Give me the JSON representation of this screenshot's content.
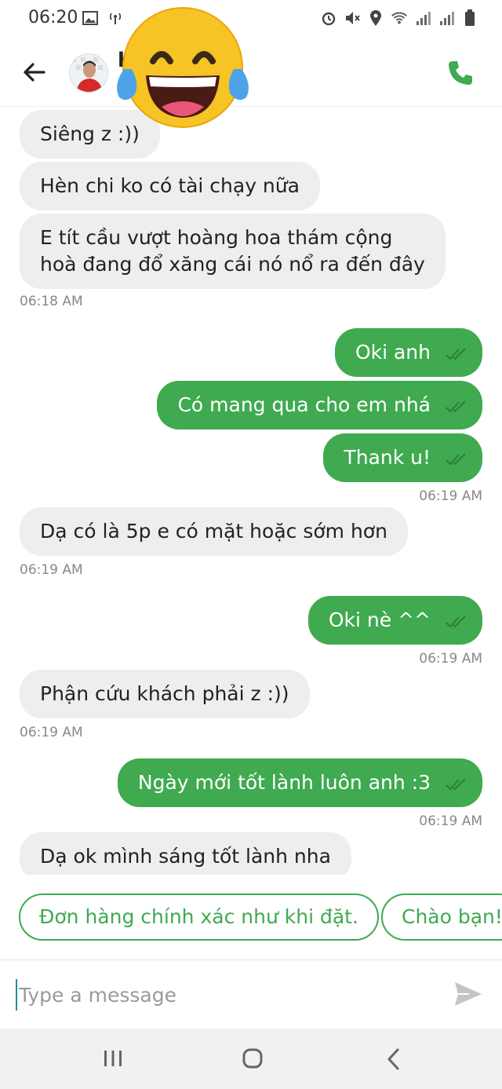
{
  "status_bar": {
    "time": "06:20",
    "icons_left": [
      "image-icon",
      "hotspot-icon"
    ],
    "icons_right": [
      "alarm-icon",
      "mute-icon",
      "location-icon",
      "wifi-icon",
      "signal-icon",
      "signal-icon",
      "battery-icon"
    ]
  },
  "header": {
    "contact_name": "b        y",
    "icons": [
      "back-arrow-icon",
      "phone-icon"
    ],
    "accent_color": "#3faa4f"
  },
  "messages": [
    {
      "dir": "in",
      "text": "Siêng z :))"
    },
    {
      "dir": "in",
      "text": "Hèn chi ko có tài chạy nữa"
    },
    {
      "dir": "in",
      "text_lines": [
        "E tít cầu vượt hoàng hoa thám cộng",
        "hoà đang đổ xăng cái nó nổ ra đến đây"
      ]
    },
    {
      "dir": "time",
      "text": "06:18 AM"
    },
    {
      "dir": "out",
      "text": "Oki anh"
    },
    {
      "dir": "out",
      "text": "Có mang qua cho em nhá"
    },
    {
      "dir": "out",
      "text": "Thank u!"
    },
    {
      "dir": "time",
      "text": "06:19 AM"
    },
    {
      "dir": "in",
      "text": "Dạ có là 5p e có mặt hoặc sớm hơn"
    },
    {
      "dir": "time",
      "text": "06:19 AM"
    },
    {
      "dir": "out",
      "text": "Oki nè ^^"
    },
    {
      "dir": "time",
      "text": "06:19 AM"
    },
    {
      "dir": "in",
      "text": "Phận cứu khách phải z :))"
    },
    {
      "dir": "time",
      "text": "06:19 AM"
    },
    {
      "dir": "out",
      "text": "Ngày mới tốt lành luôn anh :3"
    },
    {
      "dir": "time",
      "text": "06:19 AM"
    },
    {
      "dir": "in",
      "text": "Dạ ok mình sáng tốt lành nha"
    }
  ],
  "quick_replies": [
    "Đơn hàng chính xác như khi đặt.",
    "Chào bạn!"
  ],
  "composer": {
    "placeholder": "Type a message"
  },
  "nav": [
    "recent-apps-icon",
    "home-icon",
    "back-icon"
  ],
  "colors": {
    "outgoing_bubble": "#3faa4f",
    "incoming_bubble": "#eeeeee"
  }
}
